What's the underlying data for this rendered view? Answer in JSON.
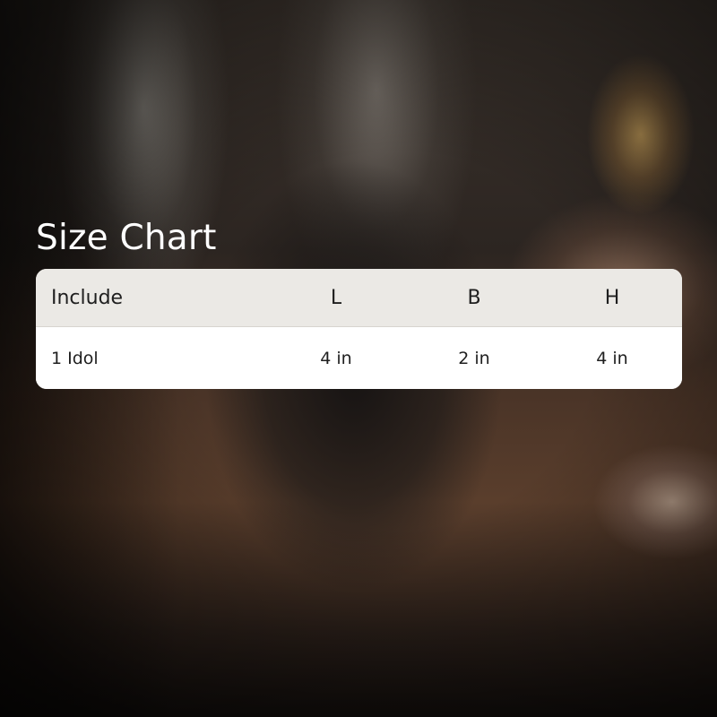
{
  "title": "Size Chart",
  "table": {
    "headers": [
      "Include",
      "L",
      "B",
      "H"
    ],
    "rows": [
      [
        "1 Idol",
        "4 in",
        "2 in",
        "4 in"
      ]
    ]
  }
}
